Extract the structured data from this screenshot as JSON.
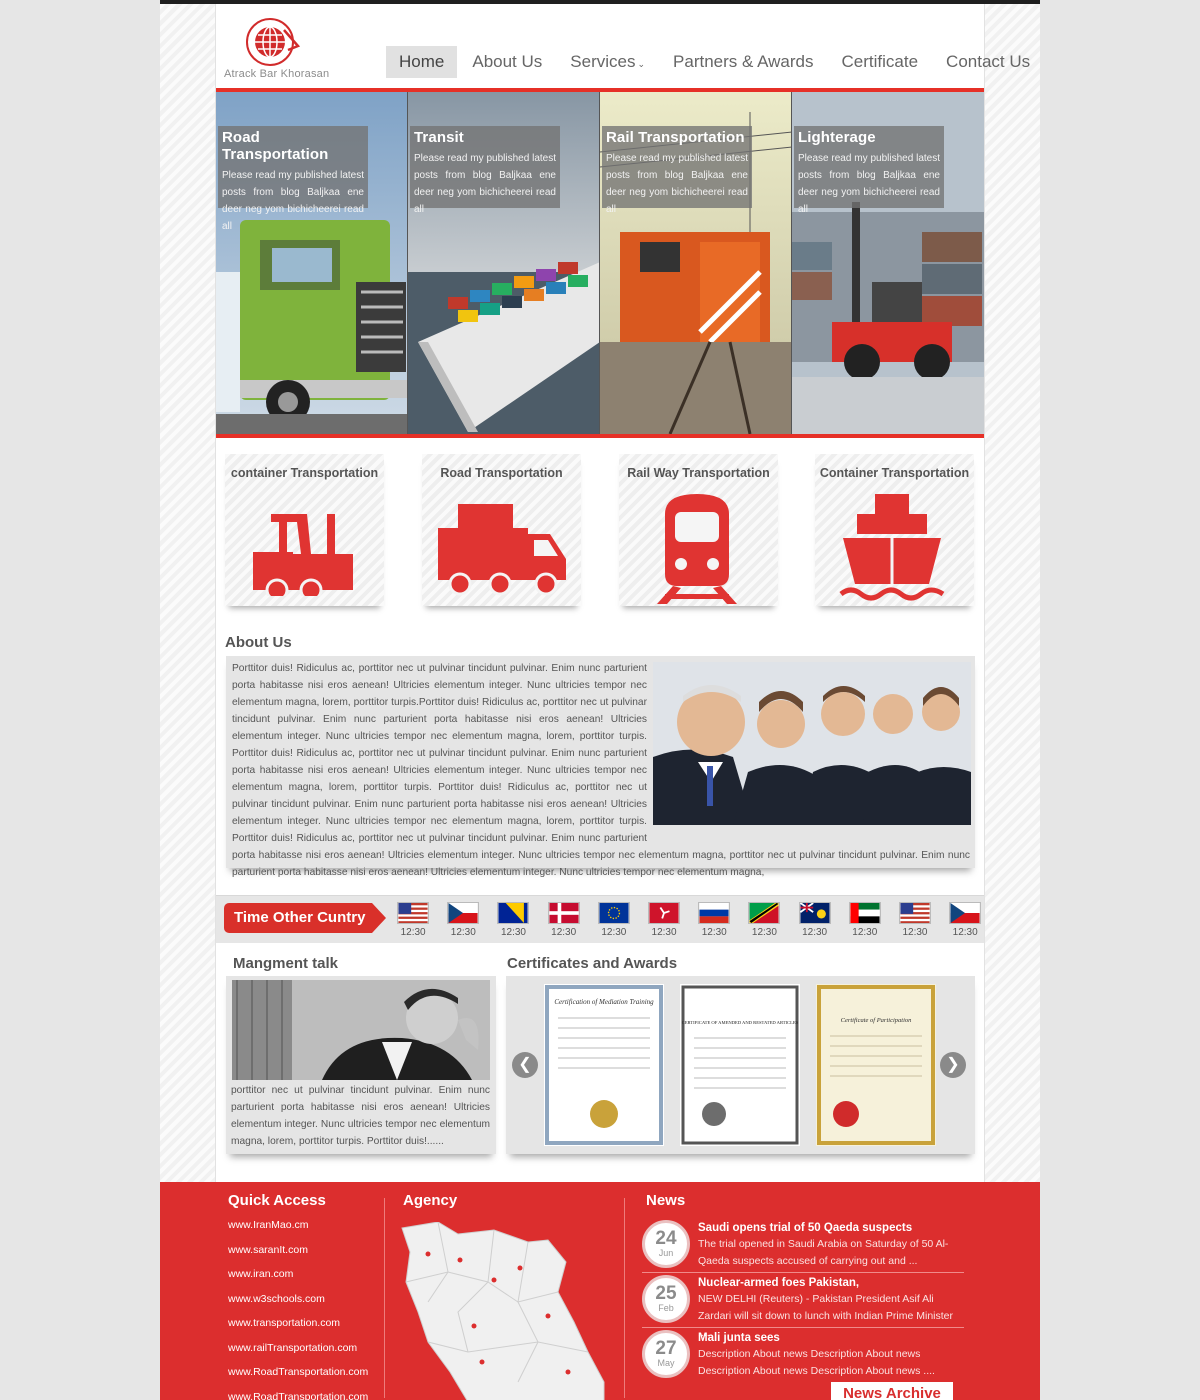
{
  "brand": {
    "name": "Atrack Bar Khorasan"
  },
  "nav": [
    {
      "label": "Home",
      "active": true
    },
    {
      "label": "About Us"
    },
    {
      "label": "Services"
    },
    {
      "label": "Partners & Awards"
    },
    {
      "label": "Certificate"
    },
    {
      "label": "Contact Us"
    }
  ],
  "slides": [
    {
      "title": "Road Transportation",
      "text": "Please read my published latest posts from blog Baljkaa ene deer neg yom bichicheerei read all"
    },
    {
      "title": "Transit",
      "text": "Please read my published latest posts from blog Baljkaa ene deer neg yom bichicheerei read all"
    },
    {
      "title": "Rail Transportation",
      "text": "Please read my published latest posts from blog Baljkaa ene deer neg yom bichicheerei read all"
    },
    {
      "title": "Lighterage",
      "text": "Please read my published latest posts from blog Baljkaa ene deer neg yom bichicheerei read all"
    }
  ],
  "services": [
    {
      "label": "container Transportation",
      "icon": "forklift-icon"
    },
    {
      "label": "Road Transportation",
      "icon": "truck-icon"
    },
    {
      "label": "Rail Way Transportation",
      "icon": "train-icon"
    },
    {
      "label": "Container Transportation",
      "icon": "ship-icon"
    }
  ],
  "about": {
    "heading": "About Us",
    "text": "Porttitor duis! Ridiculus ac, porttitor nec ut pulvinar tincidunt pulvinar. Enim nunc parturient porta habitasse nisi eros aenean! Ultricies elementum integer. Nunc ultricies tempor nec elementum magna, lorem, porttitor turpis.Porttitor duis! Ridiculus ac, porttitor nec ut pulvinar tincidunt pulvinar. Enim nunc parturient porta habitasse nisi eros aenean! Ultricies elementum integer. Nunc ultricies tempor nec elementum magna, lorem, porttitor turpis. Porttitor duis! Ridiculus ac, porttitor nec ut pulvinar tincidunt pulvinar. Enim nunc parturient porta habitasse nisi eros aenean! Ultricies elementum integer. Nunc ultricies tempor nec elementum magna, lorem, porttitor turpis. Porttitor duis! Ridiculus ac, porttitor nec ut pulvinar tincidunt pulvinar. Enim nunc parturient porta habitasse nisi eros aenean! Ultricies elementum integer. Nunc ultricies tempor nec elementum magna, lorem, porttitor turpis. Porttitor duis! Ridiculus ac, porttitor nec ut pulvinar tincidunt pulvinar. Enim nunc parturient porta habitasse nisi eros aenean! Ultricies elementum integer. Nunc ultricies tempor nec elementum magna, porttitor nec ut pulvinar tincidunt pulvinar. Enim nunc parturient porta habitasse nisi eros aenean! Ultricies elementum integer. Nunc ultricies tempor nec elementum magna,"
  },
  "time_bar": {
    "label": "Time Other Cuntry",
    "flags": [
      {
        "country": "usa-flag-icon",
        "time": "12:30"
      },
      {
        "country": "czech-flag-icon",
        "time": "12:30"
      },
      {
        "country": "bosnia-flag-icon",
        "time": "12:30"
      },
      {
        "country": "denmark-flag-icon",
        "time": "12:30"
      },
      {
        "country": "eu-flag-icon",
        "time": "12:30"
      },
      {
        "country": "isle-of-man-flag-icon",
        "time": "12:30"
      },
      {
        "country": "russia-flag-icon",
        "time": "12:30"
      },
      {
        "country": "saint-kitts-flag-icon",
        "time": "12:30"
      },
      {
        "country": "turks-caicos-flag-icon",
        "time": "12:30"
      },
      {
        "country": "uae-flag-icon",
        "time": "12:30"
      },
      {
        "country": "usa-flag-icon",
        "time": "12:30"
      },
      {
        "country": "czech-flag-icon",
        "time": "12:30"
      }
    ]
  },
  "management": {
    "heading": "Mangment talk",
    "text": "porttitor nec ut pulvinar tincidunt pulvinar. Enim nunc parturient porta habitasse nisi eros aenean! Ultricies elementum integer. Nunc ultricies tempor nec elementum magna, lorem, porttitor turpis. Porttitor duis!......"
  },
  "certificates": {
    "heading": "Certificates and Awards",
    "items": [
      {
        "title": "Certification of Mediation Training"
      },
      {
        "title": "CERTIFICATE OF AMENDED AND RESTATED ARTICLES"
      },
      {
        "title": "Certificate of Participation"
      }
    ]
  },
  "footer": {
    "quick_access": {
      "heading": "Quick Access",
      "links": [
        "www.IranMao.cm",
        "www.saranIt.com",
        "www.iran.com",
        "www.w3schools.com",
        "www.transportation.com",
        "www.railTransportation.com",
        "www.RoadTransportation.com",
        "www.RoadTransportation.com"
      ]
    },
    "agency": {
      "heading": "Agency"
    },
    "news": {
      "heading": "News",
      "items": [
        {
          "day": "24",
          "month": "Jun",
          "title": "Saudi opens trial of 50 Qaeda suspects",
          "text": "The trial opened in Saudi Arabia on Saturday of 50 Al-Qaeda suspects accused of carrying out and ..."
        },
        {
          "day": "25",
          "month": "Feb",
          "title": "Nuclear-armed foes Pakistan,",
          "text": "NEW DELHI (Reuters) - Pakistan President Asif Ali Zardari will sit down to lunch with Indian Prime Minister ...."
        },
        {
          "day": "27",
          "month": "May",
          "title": "Mali junta sees",
          "text": "Description About news Description About news Description About news Description About news ...."
        }
      ],
      "archive_label": "News Archive"
    }
  },
  "colors": {
    "accent": "#e63027",
    "footer": "#dc2e2e",
    "icon": "#e03432"
  }
}
